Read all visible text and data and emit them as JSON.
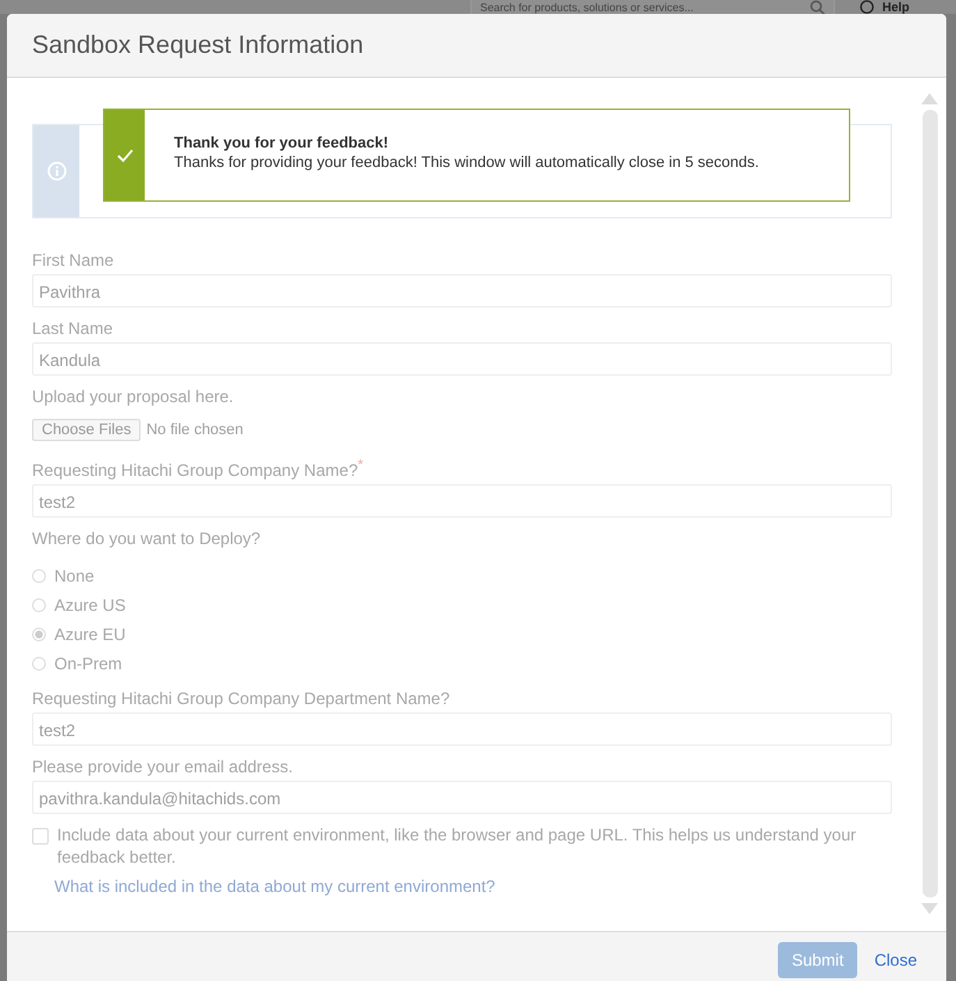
{
  "background": {
    "search_placeholder": "Search for products, solutions or services...",
    "help_label": "Help"
  },
  "dialog": {
    "title": "Sandbox Request Information"
  },
  "toast": {
    "title": "Thank you for your feedback!",
    "message": "Thanks for providing your feedback! This window will automatically close in 5 seconds."
  },
  "form": {
    "fields": [
      {
        "kind": "text",
        "label": "First Name",
        "value": "Pavithra"
      },
      {
        "kind": "text",
        "label": "Last Name",
        "value": "Kandula"
      },
      {
        "kind": "file",
        "label": "Upload your proposal here.",
        "button": "Choose Files",
        "status": "No file chosen"
      },
      {
        "kind": "text",
        "label": "Requesting Hitachi Group Company Name?",
        "required_mark": "*",
        "value": "test2"
      },
      {
        "kind": "radio",
        "label": "Where do you want to Deploy?",
        "options": [
          {
            "label": "None",
            "selected": false
          },
          {
            "label": "Azure US",
            "selected": false
          },
          {
            "label": "Azure EU",
            "selected": true
          },
          {
            "label": "On-Prem",
            "selected": false
          }
        ]
      },
      {
        "kind": "text",
        "label": "Requesting Hitachi Group Company Department Name?",
        "value": "test2"
      },
      {
        "kind": "text",
        "label": "Please provide your email address.",
        "value": "pavithra.kandula@hitachids.com"
      }
    ],
    "consent": {
      "checked": false,
      "label": "Include data about your current environment, like the browser and page URL. This helps us understand your feedback better."
    },
    "link": "What is included in the data about my current environment?"
  },
  "footer": {
    "submit": "Submit",
    "close": "Close"
  }
}
